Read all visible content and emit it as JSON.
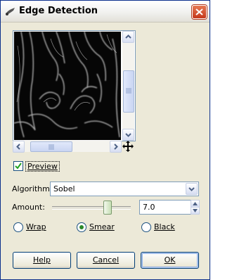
{
  "window": {
    "title": "Edge Detection",
    "close_icon": "close-icon",
    "app_icon": "gimp-brush-icon"
  },
  "preview": {
    "checkbox_checked": true,
    "label": "Preview",
    "move_icon": "move-icon"
  },
  "algorithm": {
    "label": "Algorithm:",
    "value": "Sobel"
  },
  "amount": {
    "label": "Amount:",
    "value": "7.0",
    "slider_fraction": 0.7
  },
  "edge_mode": {
    "options": [
      {
        "label": "Wrap",
        "selected": false
      },
      {
        "label": "Smear",
        "selected": true
      },
      {
        "label": "Black",
        "selected": false
      }
    ]
  },
  "buttons": {
    "help": "Help",
    "cancel": "Cancel",
    "ok": "OK"
  },
  "colors": {
    "title_gradient_top": "#ffffff",
    "close_red": "#c4371b",
    "window_bg": "#ece9d8",
    "radio_dot": "#2b8a2b"
  }
}
